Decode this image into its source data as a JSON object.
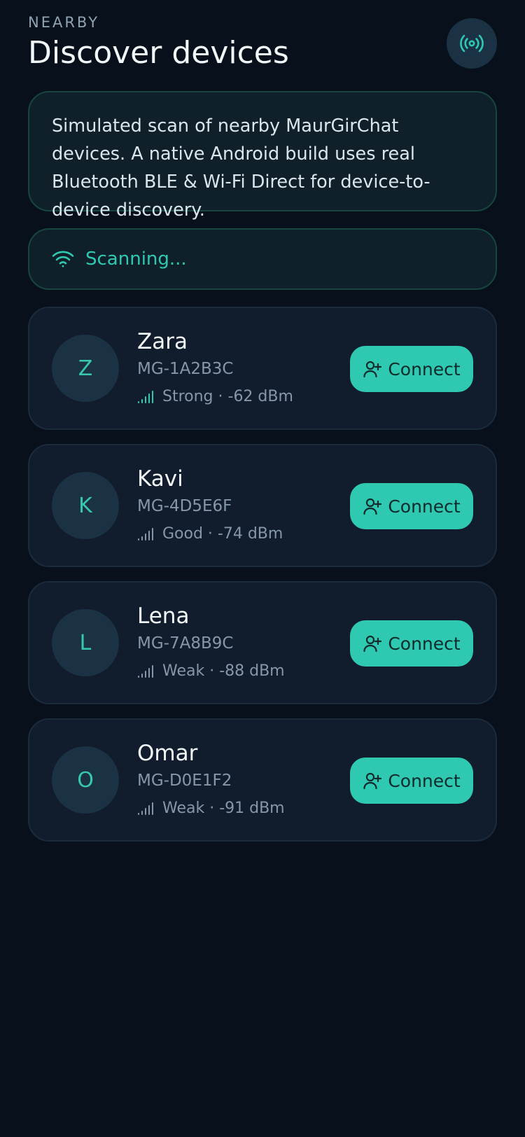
{
  "header": {
    "eyebrow": "NEARBY",
    "title": "Discover devices",
    "action_icon": "broadcast-icon"
  },
  "info": {
    "text": "Simulated scan of nearby MaurGirChat devices. A native Android build uses real Bluetooth BLE & Wi-Fi Direct for device-to-device discovery."
  },
  "scan": {
    "status": "Scanning...",
    "icon": "wifi-icon"
  },
  "devices": [
    {
      "initial": "Z",
      "name": "Zara",
      "id": "MG-1A2B3C",
      "signal": "Strong · -62 dBm",
      "strength": "strong",
      "connect_label": "Connect"
    },
    {
      "initial": "K",
      "name": "Kavi",
      "id": "MG-4D5E6F",
      "signal": "Good · -74 dBm",
      "strength": "good",
      "connect_label": "Connect"
    },
    {
      "initial": "L",
      "name": "Lena",
      "id": "MG-7A8B9C",
      "signal": "Weak · -88 dBm",
      "strength": "weak",
      "connect_label": "Connect"
    },
    {
      "initial": "O",
      "name": "Omar",
      "id": "MG-D0E1F2",
      "signal": "Weak · -91 dBm",
      "strength": "weak",
      "connect_label": "Connect"
    }
  ],
  "colors": {
    "background": "#08111b",
    "accent": "#2fc9b1",
    "card": "#111d2d",
    "muted": "#8597a8"
  }
}
